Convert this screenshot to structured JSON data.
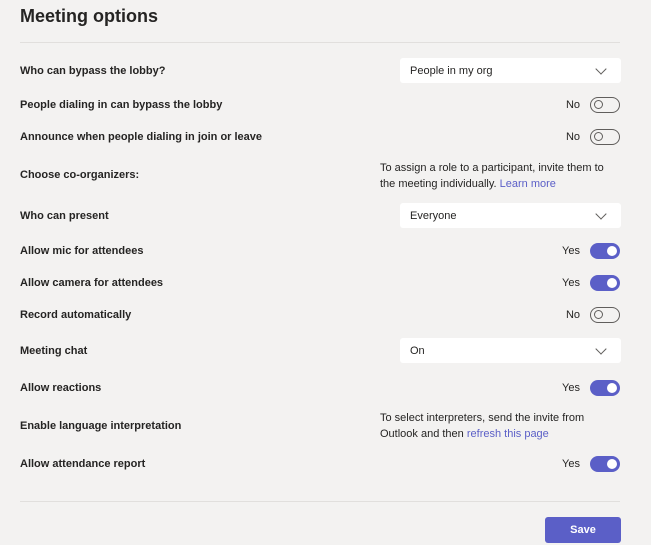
{
  "title": "Meeting options",
  "rows": [
    {
      "label": "Who can bypass the lobby?",
      "type": "dropdown",
      "value": "People in my org"
    },
    {
      "label": "People dialing in can bypass the lobby",
      "type": "toggle",
      "state": "No",
      "on": false
    },
    {
      "label": "Announce when people dialing in join or leave",
      "type": "toggle",
      "state": "No",
      "on": false
    },
    {
      "label": "Choose co-organizers:",
      "type": "info",
      "text": "To assign a role to a participant, invite them to the meeting individually.",
      "link": "Learn more"
    },
    {
      "label": "Who can present",
      "type": "dropdown",
      "value": "Everyone"
    },
    {
      "label": "Allow mic for attendees",
      "type": "toggle",
      "state": "Yes",
      "on": true
    },
    {
      "label": "Allow camera for attendees",
      "type": "toggle",
      "state": "Yes",
      "on": true
    },
    {
      "label": "Record automatically",
      "type": "toggle",
      "state": "No",
      "on": false
    },
    {
      "label": "Meeting chat",
      "type": "dropdown",
      "value": "On"
    },
    {
      "label": "Allow reactions",
      "type": "toggle",
      "state": "Yes",
      "on": true
    },
    {
      "label": "Enable language interpretation",
      "type": "info",
      "text": "To select interpreters, send the invite from Outlook and then",
      "link": "refresh this page"
    },
    {
      "label": "Allow attendance report",
      "type": "toggle",
      "state": "Yes",
      "on": true
    }
  ],
  "save_label": "Save",
  "colors": {
    "accent": "#5b5fc7",
    "background": "#f3f2f1"
  }
}
